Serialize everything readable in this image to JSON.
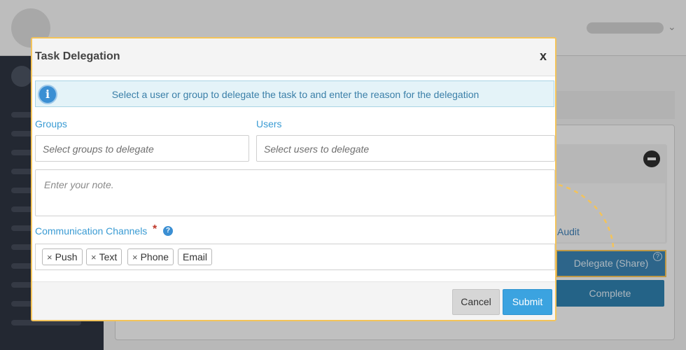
{
  "background": {
    "audit_link": "Audit",
    "delegate_button": "Delegate (Share)",
    "complete_button": "Complete",
    "help_glyph": "?"
  },
  "modal": {
    "title": "Task Delegation",
    "close_glyph": "x",
    "info_text": "Select a user or group to delegate the task to and enter the reason for the delegation",
    "info_glyph": "i",
    "groups": {
      "label": "Groups",
      "placeholder": "Select groups to delegate"
    },
    "users": {
      "label": "Users",
      "placeholder": "Select users to delegate"
    },
    "note": {
      "placeholder": "Enter your note."
    },
    "comm": {
      "label": "Communication Channels",
      "required": "*",
      "help_glyph": "?",
      "remove_glyph": "×",
      "tags": [
        "Push",
        "Text",
        "Phone",
        "Email"
      ]
    },
    "cancel_label": "Cancel",
    "submit_label": "Submit"
  },
  "colors": {
    "accent": "#3ba3e0",
    "highlight_border": "#f3c35a",
    "label_blue": "#3a9bd3",
    "required": "#c0392b"
  },
  "icons": [
    "info-icon",
    "close-icon",
    "help-icon",
    "minus-circle-icon",
    "chevron-down-icon",
    "dashed-arrow-icon"
  ]
}
